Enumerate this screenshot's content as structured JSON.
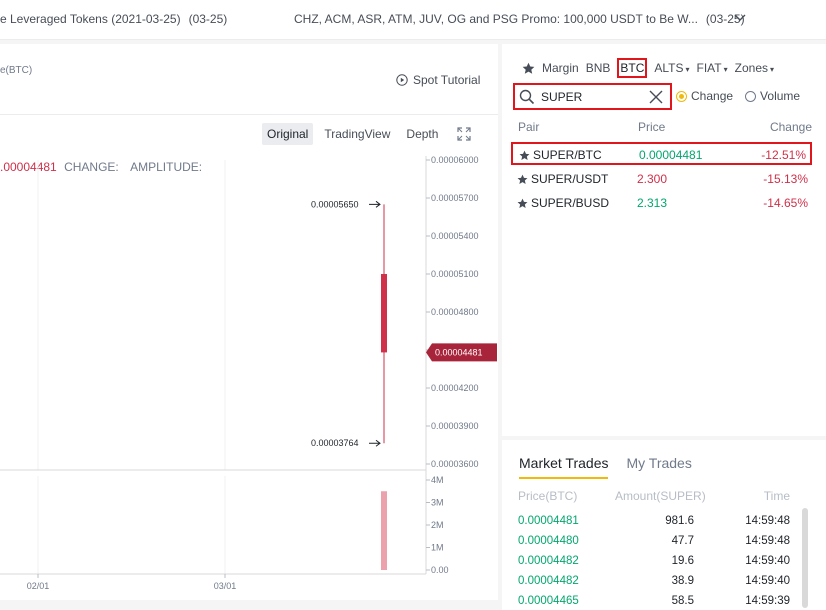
{
  "announcements": {
    "left_text": "e Leveraged Tokens (2021-03-25)",
    "left_date": "(03-25)",
    "right_text": "CHZ, ACM, ASR, ATM, JUV, OG and PSG Promo: 100,000 USDT to Be W...",
    "right_date": "(03-25)",
    "chevron_icon": "chevron-down-icon"
  },
  "chart": {
    "pair_sub": "e(BTC)",
    "spot_tutorial": "Spot Tutorial",
    "tabs": [
      "Original",
      "TradingView",
      "Depth"
    ],
    "active_tab": "Original",
    "ohlc": {
      "value": ".00004481",
      "change_label": "CHANGE:",
      "amplitude_label": "AMPLITUDE:"
    },
    "high_label": "0.00005650",
    "low_label": "0.00003764",
    "last_price_tag": "0.00004481",
    "price_axis": [
      "0.00006000",
      "0.00005700",
      "0.00005400",
      "0.00005100",
      "0.00004800",
      "0.00004500",
      "0.00004200",
      "0.00003900",
      "0.00003600"
    ],
    "volume_axis": [
      "4M",
      "3M",
      "2M",
      "1M",
      "0.00"
    ],
    "date_axis": [
      "02/01",
      "03/01"
    ],
    "candle": {
      "open": 5.1e-05,
      "high": 5.65e-05,
      "low": 3.764e-05,
      "close": 4.481e-05
    },
    "volume_bar": 3.5
  },
  "market": {
    "tabs": [
      {
        "label": "Margin"
      },
      {
        "label": "BNB"
      },
      {
        "label": "BTC"
      },
      {
        "label": "ALTS",
        "caret": "▾"
      },
      {
        "label": "FIAT",
        "caret": "▾"
      },
      {
        "label": "Zones",
        "caret": "▾"
      }
    ],
    "search_value": "SUPER",
    "radios": {
      "change": "Change",
      "volume": "Volume"
    },
    "headers": {
      "pair": "Pair",
      "price": "Price",
      "change": "Change"
    },
    "rows": [
      {
        "pair": "SUPER/BTC",
        "price": "0.00004481",
        "change": "-12.51%",
        "price_color": "green"
      },
      {
        "pair": "SUPER/USDT",
        "price": "2.300",
        "change": "-15.13%",
        "price_color": "red"
      },
      {
        "pair": "SUPER/BUSD",
        "price": "2.313",
        "change": "-14.65%",
        "price_color": "green"
      }
    ]
  },
  "trades": {
    "tabs": [
      "Market Trades",
      "My Trades"
    ],
    "headers": {
      "price": "Price(BTC)",
      "amount": "Amount(SUPER)",
      "time": "Time"
    },
    "rows": [
      {
        "price": "0.00004481",
        "amount": "981.6",
        "time": "14:59:48"
      },
      {
        "price": "0.00004480",
        "amount": "47.7",
        "time": "14:59:48"
      },
      {
        "price": "0.00004482",
        "amount": "19.6",
        "time": "14:59:40"
      },
      {
        "price": "0.00004482",
        "amount": "38.9",
        "time": "14:59:40"
      },
      {
        "price": "0.00004465",
        "amount": "58.5",
        "time": "14:59:39"
      }
    ]
  },
  "colors": {
    "up": "#03a66d",
    "down": "#cf304a",
    "accent": "#f0b90b",
    "highlight_box": "#e0161c"
  }
}
